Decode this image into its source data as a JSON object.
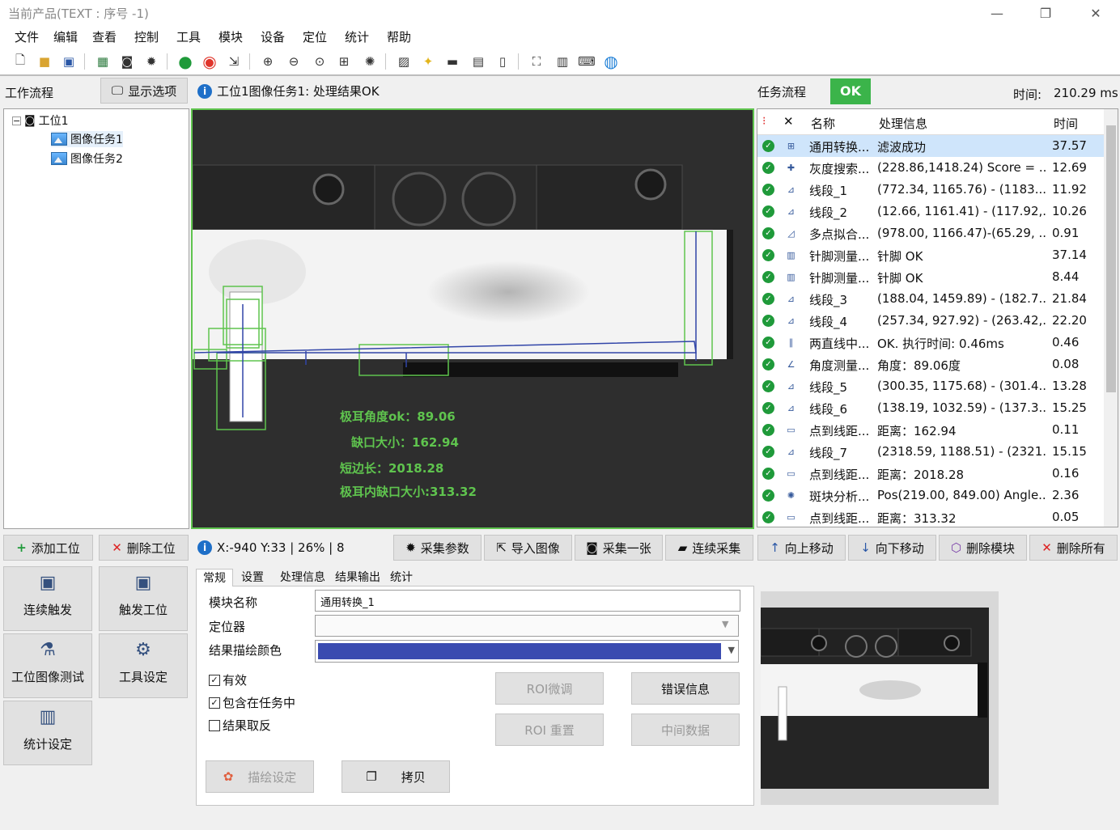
{
  "window": {
    "title": "当前产品(TEXT : 序号 -1)",
    "minimize": "—",
    "restore": "❐",
    "close": "✕"
  },
  "menu": [
    "文件",
    "编辑",
    "查看",
    "控制",
    "工具",
    "模块",
    "设备",
    "定位",
    "统计",
    "帮助"
  ],
  "toolbar_icons": [
    "new-file-icon",
    "open-folder-icon",
    "save-icon",
    "grid-icon",
    "camera-icon",
    "gear-icon",
    "run-icon",
    "stop-icon",
    "export-icon",
    "zoom-in-icon",
    "zoom-out-icon",
    "zoom-fit-icon",
    "measure-icon",
    "settings-icon",
    "image-icon",
    "bulb-icon",
    "toolbox-icon",
    "device-icon",
    "panel-icon",
    "fullscreen-icon",
    "calculator-icon",
    "keyboard-icon",
    "help-icon"
  ],
  "workflow": {
    "title": "工作流程",
    "display_options": "显示选项",
    "station": "工位1",
    "tasks": [
      "图像任务1",
      "图像任务2"
    ]
  },
  "result_bar": {
    "message": "工位1图像任务1: 处理结果OK"
  },
  "task_flow": {
    "title": "任务流程",
    "status": "OK",
    "time_label": "时间:",
    "time_value": "210.29 ms"
  },
  "overlay_text": [
    "极耳角度ok：89.06",
    "缺口大小：162.94",
    "短边长：2018.28",
    "极耳内缺口大小:313.32"
  ],
  "task_table": {
    "columns": [
      "名称",
      "处理信息",
      "时间"
    ],
    "rows": [
      {
        "name": "通用转换...",
        "info": "滤波成功",
        "time": "37.57",
        "selected": true,
        "icon": "transform-icon"
      },
      {
        "name": "灰度搜索...",
        "info": "(228.86,1418.24) Score = ...",
        "time": "12.69",
        "icon": "gray-search-icon"
      },
      {
        "name": "线段_1",
        "info": "(772.34, 1165.76) - (1183....",
        "time": "11.92",
        "icon": "line-segment-icon"
      },
      {
        "name": "线段_2",
        "info": "(12.66, 1161.41) - (117.92,...",
        "time": "10.26",
        "icon": "line-segment-icon"
      },
      {
        "name": "多点拟合...",
        "info": "(978.00, 1166.47)-(65.29, ...",
        "time": "0.91",
        "icon": "fit-icon"
      },
      {
        "name": "针脚测量...",
        "info": "针脚 OK",
        "time": "37.14",
        "icon": "pin-measure-icon"
      },
      {
        "name": "针脚测量...",
        "info": "针脚 OK",
        "time": "8.44",
        "icon": "pin-measure-icon"
      },
      {
        "name": "线段_3",
        "info": "(188.04, 1459.89) - (182.7...",
        "time": "21.84",
        "icon": "line-segment-icon"
      },
      {
        "name": "线段_4",
        "info": "(257.34, 927.92) - (263.42,...",
        "time": "22.20",
        "icon": "line-segment-icon"
      },
      {
        "name": "两直线中...",
        "info": "OK. 执行时间: 0.46ms",
        "time": "0.46",
        "icon": "midline-icon"
      },
      {
        "name": "角度测量...",
        "info": "角度：89.06度",
        "time": "0.08",
        "icon": "angle-icon"
      },
      {
        "name": "线段_5",
        "info": "(300.35, 1175.68) - (301.4...",
        "time": "13.28",
        "icon": "line-segment-icon"
      },
      {
        "name": "线段_6",
        "info": "(138.19, 1032.59) - (137.3...",
        "time": "15.25",
        "icon": "line-segment-icon"
      },
      {
        "name": "点到线距...",
        "info": "距离：162.94",
        "time": "0.11",
        "icon": "distance-icon"
      },
      {
        "name": "线段_7",
        "info": "(2318.59, 1188.51) - (2321...",
        "time": "15.15",
        "icon": "line-segment-icon"
      },
      {
        "name": "点到线距...",
        "info": "距离：2018.28",
        "time": "0.16",
        "icon": "distance-icon"
      },
      {
        "name": "斑块分析...",
        "info": "Pos(219.00, 849.00) Angle...",
        "time": "2.36",
        "icon": "blob-icon"
      },
      {
        "name": "点到线距...",
        "info": "距离：313.32",
        "time": "0.05",
        "icon": "distance-icon"
      }
    ]
  },
  "actions": {
    "add_station": "添加工位",
    "delete_station": "删除工位",
    "status": "X:-940 Y:33 | 26% | 8",
    "capture_params": "采集参数",
    "import_image": "导入图像",
    "capture_one": "采集一张",
    "continuous_capture": "连续采集",
    "move_up": "向上移动",
    "move_down": "向下移动",
    "delete_module": "删除模块",
    "delete_all": "删除所有"
  },
  "big_buttons": [
    "连续触发",
    "触发工位",
    "工位图像测试",
    "工具设定",
    "统计设定"
  ],
  "tabs": [
    "常规",
    "设置",
    "处理信息",
    "结果输出",
    "统计"
  ],
  "props": {
    "module_name_label": "模块名称",
    "module_name": "通用转换_1",
    "locator_label": "定位器",
    "locator": "",
    "color_label": "结果描绘颜色",
    "color": "#3a4bb0",
    "valid": "有效",
    "include": "包含在任务中",
    "invert": "结果取反",
    "roi_tune": "ROI微调",
    "error_info": "错误信息",
    "roi_reset": "ROI 重置",
    "intermediate": "中间数据",
    "draw_settings": "描绘设定",
    "copy": "拷贝"
  }
}
